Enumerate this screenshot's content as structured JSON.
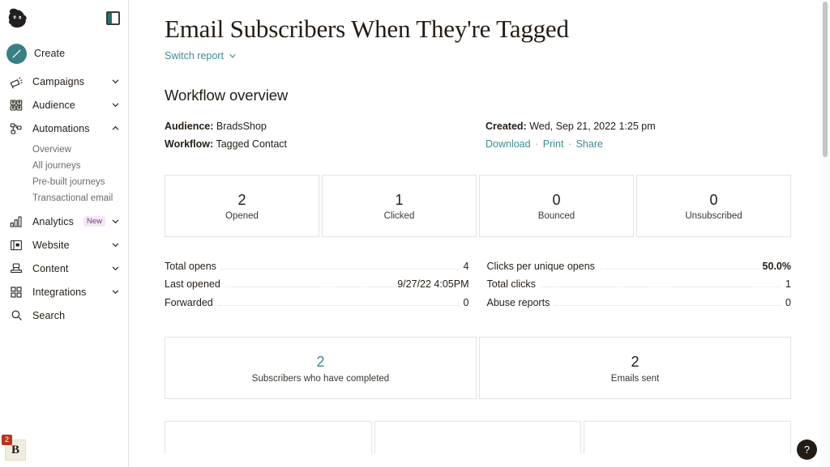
{
  "colors": {
    "accent_teal": "#3f8a92",
    "create_button": "#3b7f86",
    "badge_new_bg": "#f4e6f6",
    "notification_red": "#b8351f",
    "text": "#241c15",
    "card_border": "#e3e3e0"
  },
  "sidebar": {
    "logo_name": "mailchimp-freddie-logo",
    "panel_toggle_name": "collapse-sidebar-icon",
    "create": {
      "label": "Create",
      "icon": "pencil-icon"
    },
    "items": [
      {
        "label": "Campaigns",
        "icon": "megaphone-icon",
        "caret": "chevron-down-icon",
        "expanded": false
      },
      {
        "label": "Audience",
        "icon": "people-grid-icon",
        "caret": "chevron-down-icon",
        "expanded": false
      },
      {
        "label": "Automations",
        "icon": "workflow-nodes-icon",
        "caret": "chevron-up-icon",
        "expanded": true
      },
      {
        "label": "Analytics",
        "icon": "bar-chart-icon",
        "caret": "chevron-down-icon",
        "badge": "New",
        "expanded": false
      },
      {
        "label": "Website",
        "icon": "browser-window-icon",
        "caret": "chevron-down-icon",
        "expanded": false
      },
      {
        "label": "Content",
        "icon": "content-stamp-icon",
        "caret": "chevron-down-icon",
        "expanded": false
      },
      {
        "label": "Integrations",
        "icon": "grid-squares-icon",
        "caret": "chevron-down-icon",
        "expanded": false
      },
      {
        "label": "Search",
        "icon": "search-icon",
        "caret": null,
        "expanded": false
      }
    ],
    "automations_subitems": [
      {
        "label": "Overview"
      },
      {
        "label": "All journeys"
      },
      {
        "label": "Pre-built journeys"
      },
      {
        "label": "Transactional email"
      }
    ],
    "bottom_app": {
      "letter": "B",
      "badge_count": "2"
    }
  },
  "header": {
    "title": "Email Subscribers When They're Tagged",
    "switch_report_label": "Switch report",
    "switch_report_caret": "chevron-down-icon"
  },
  "overview": {
    "section_title": "Workflow overview",
    "audience_label": "Audience:",
    "audience_value": "BradsShop",
    "workflow_label": "Workflow:",
    "workflow_value": "Tagged Contact",
    "created_label": "Created:",
    "created_value": "Wed, Sep 21, 2022 1:25 pm",
    "actions": [
      {
        "label": "Download"
      },
      {
        "label": "Print"
      },
      {
        "label": "Share"
      }
    ],
    "action_separator": "·"
  },
  "stat_cards_row1": [
    {
      "value": "2",
      "label": "Opened",
      "link": false
    },
    {
      "value": "1",
      "label": "Clicked",
      "link": false
    },
    {
      "value": "0",
      "label": "Bounced",
      "link": false
    },
    {
      "value": "0",
      "label": "Unsubscribed",
      "link": false
    }
  ],
  "stat_lists": {
    "left": [
      {
        "label": "Total opens",
        "value": "4",
        "bold": false
      },
      {
        "label": "Last opened",
        "value": "9/27/22 4:05PM",
        "bold": false
      },
      {
        "label": "Forwarded",
        "value": "0",
        "bold": false
      }
    ],
    "right": [
      {
        "label": "Clicks per unique opens",
        "value": "50.0%",
        "bold": true
      },
      {
        "label": "Total clicks",
        "value": "1",
        "bold": false
      },
      {
        "label": "Abuse reports",
        "value": "0",
        "bold": false
      }
    ]
  },
  "stat_cards_row2": [
    {
      "value": "2",
      "label": "Subscribers who have completed",
      "link": true
    },
    {
      "value": "2",
      "label": "Emails sent",
      "link": false
    }
  ],
  "stat_cards_row3": [
    {
      "value": "",
      "label": "",
      "link": false
    },
    {
      "value": "",
      "label": "",
      "link": false
    },
    {
      "value": "",
      "label": "",
      "link": false
    }
  ],
  "help": {
    "label": "?"
  }
}
